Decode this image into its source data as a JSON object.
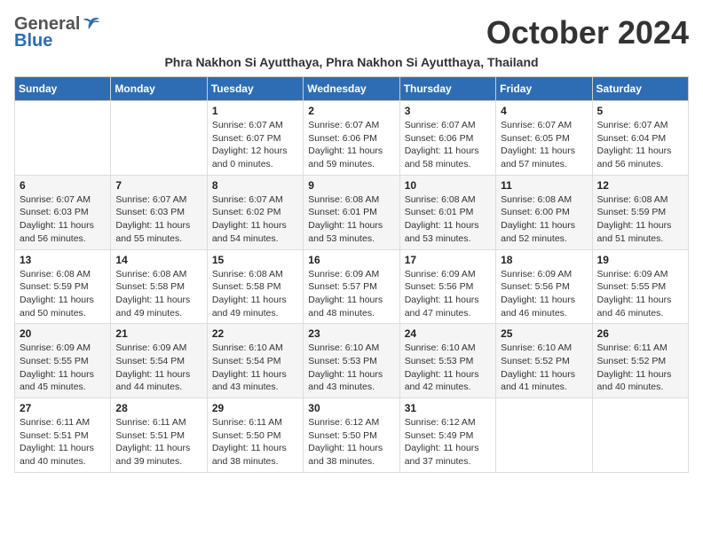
{
  "logo": {
    "general": "General",
    "blue": "Blue",
    "tagline": ""
  },
  "title": "October 2024",
  "subtitle": "Phra Nakhon Si Ayutthaya, Phra Nakhon Si Ayutthaya, Thailand",
  "headers": [
    "Sunday",
    "Monday",
    "Tuesday",
    "Wednesday",
    "Thursday",
    "Friday",
    "Saturday"
  ],
  "weeks": [
    [
      {
        "day": "",
        "sunrise": "",
        "sunset": "",
        "daylight": ""
      },
      {
        "day": "",
        "sunrise": "",
        "sunset": "",
        "daylight": ""
      },
      {
        "day": "1",
        "sunrise": "Sunrise: 6:07 AM",
        "sunset": "Sunset: 6:07 PM",
        "daylight": "Daylight: 12 hours and 0 minutes."
      },
      {
        "day": "2",
        "sunrise": "Sunrise: 6:07 AM",
        "sunset": "Sunset: 6:06 PM",
        "daylight": "Daylight: 11 hours and 59 minutes."
      },
      {
        "day": "3",
        "sunrise": "Sunrise: 6:07 AM",
        "sunset": "Sunset: 6:06 PM",
        "daylight": "Daylight: 11 hours and 58 minutes."
      },
      {
        "day": "4",
        "sunrise": "Sunrise: 6:07 AM",
        "sunset": "Sunset: 6:05 PM",
        "daylight": "Daylight: 11 hours and 57 minutes."
      },
      {
        "day": "5",
        "sunrise": "Sunrise: 6:07 AM",
        "sunset": "Sunset: 6:04 PM",
        "daylight": "Daylight: 11 hours and 56 minutes."
      }
    ],
    [
      {
        "day": "6",
        "sunrise": "Sunrise: 6:07 AM",
        "sunset": "Sunset: 6:03 PM",
        "daylight": "Daylight: 11 hours and 56 minutes."
      },
      {
        "day": "7",
        "sunrise": "Sunrise: 6:07 AM",
        "sunset": "Sunset: 6:03 PM",
        "daylight": "Daylight: 11 hours and 55 minutes."
      },
      {
        "day": "8",
        "sunrise": "Sunrise: 6:07 AM",
        "sunset": "Sunset: 6:02 PM",
        "daylight": "Daylight: 11 hours and 54 minutes."
      },
      {
        "day": "9",
        "sunrise": "Sunrise: 6:08 AM",
        "sunset": "Sunset: 6:01 PM",
        "daylight": "Daylight: 11 hours and 53 minutes."
      },
      {
        "day": "10",
        "sunrise": "Sunrise: 6:08 AM",
        "sunset": "Sunset: 6:01 PM",
        "daylight": "Daylight: 11 hours and 53 minutes."
      },
      {
        "day": "11",
        "sunrise": "Sunrise: 6:08 AM",
        "sunset": "Sunset: 6:00 PM",
        "daylight": "Daylight: 11 hours and 52 minutes."
      },
      {
        "day": "12",
        "sunrise": "Sunrise: 6:08 AM",
        "sunset": "Sunset: 5:59 PM",
        "daylight": "Daylight: 11 hours and 51 minutes."
      }
    ],
    [
      {
        "day": "13",
        "sunrise": "Sunrise: 6:08 AM",
        "sunset": "Sunset: 5:59 PM",
        "daylight": "Daylight: 11 hours and 50 minutes."
      },
      {
        "day": "14",
        "sunrise": "Sunrise: 6:08 AM",
        "sunset": "Sunset: 5:58 PM",
        "daylight": "Daylight: 11 hours and 49 minutes."
      },
      {
        "day": "15",
        "sunrise": "Sunrise: 6:08 AM",
        "sunset": "Sunset: 5:58 PM",
        "daylight": "Daylight: 11 hours and 49 minutes."
      },
      {
        "day": "16",
        "sunrise": "Sunrise: 6:09 AM",
        "sunset": "Sunset: 5:57 PM",
        "daylight": "Daylight: 11 hours and 48 minutes."
      },
      {
        "day": "17",
        "sunrise": "Sunrise: 6:09 AM",
        "sunset": "Sunset: 5:56 PM",
        "daylight": "Daylight: 11 hours and 47 minutes."
      },
      {
        "day": "18",
        "sunrise": "Sunrise: 6:09 AM",
        "sunset": "Sunset: 5:56 PM",
        "daylight": "Daylight: 11 hours and 46 minutes."
      },
      {
        "day": "19",
        "sunrise": "Sunrise: 6:09 AM",
        "sunset": "Sunset: 5:55 PM",
        "daylight": "Daylight: 11 hours and 46 minutes."
      }
    ],
    [
      {
        "day": "20",
        "sunrise": "Sunrise: 6:09 AM",
        "sunset": "Sunset: 5:55 PM",
        "daylight": "Daylight: 11 hours and 45 minutes."
      },
      {
        "day": "21",
        "sunrise": "Sunrise: 6:09 AM",
        "sunset": "Sunset: 5:54 PM",
        "daylight": "Daylight: 11 hours and 44 minutes."
      },
      {
        "day": "22",
        "sunrise": "Sunrise: 6:10 AM",
        "sunset": "Sunset: 5:54 PM",
        "daylight": "Daylight: 11 hours and 43 minutes."
      },
      {
        "day": "23",
        "sunrise": "Sunrise: 6:10 AM",
        "sunset": "Sunset: 5:53 PM",
        "daylight": "Daylight: 11 hours and 43 minutes."
      },
      {
        "day": "24",
        "sunrise": "Sunrise: 6:10 AM",
        "sunset": "Sunset: 5:53 PM",
        "daylight": "Daylight: 11 hours and 42 minutes."
      },
      {
        "day": "25",
        "sunrise": "Sunrise: 6:10 AM",
        "sunset": "Sunset: 5:52 PM",
        "daylight": "Daylight: 11 hours and 41 minutes."
      },
      {
        "day": "26",
        "sunrise": "Sunrise: 6:11 AM",
        "sunset": "Sunset: 5:52 PM",
        "daylight": "Daylight: 11 hours and 40 minutes."
      }
    ],
    [
      {
        "day": "27",
        "sunrise": "Sunrise: 6:11 AM",
        "sunset": "Sunset: 5:51 PM",
        "daylight": "Daylight: 11 hours and 40 minutes."
      },
      {
        "day": "28",
        "sunrise": "Sunrise: 6:11 AM",
        "sunset": "Sunset: 5:51 PM",
        "daylight": "Daylight: 11 hours and 39 minutes."
      },
      {
        "day": "29",
        "sunrise": "Sunrise: 6:11 AM",
        "sunset": "Sunset: 5:50 PM",
        "daylight": "Daylight: 11 hours and 38 minutes."
      },
      {
        "day": "30",
        "sunrise": "Sunrise: 6:12 AM",
        "sunset": "Sunset: 5:50 PM",
        "daylight": "Daylight: 11 hours and 38 minutes."
      },
      {
        "day": "31",
        "sunrise": "Sunrise: 6:12 AM",
        "sunset": "Sunset: 5:49 PM",
        "daylight": "Daylight: 11 hours and 37 minutes."
      },
      {
        "day": "",
        "sunrise": "",
        "sunset": "",
        "daylight": ""
      },
      {
        "day": "",
        "sunrise": "",
        "sunset": "",
        "daylight": ""
      }
    ]
  ]
}
